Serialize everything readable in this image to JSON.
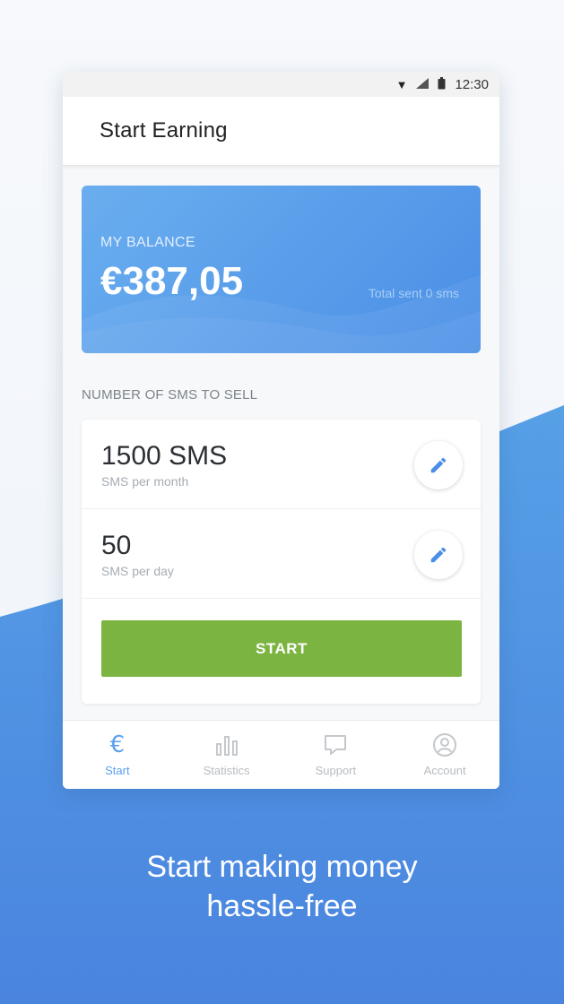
{
  "status_bar": {
    "time": "12:30",
    "icons": [
      "wifi-icon",
      "signal-icon",
      "battery-icon"
    ]
  },
  "app_bar": {
    "title": "Start Earning"
  },
  "balance": {
    "label": "MY BALANCE",
    "amount": "€387,05",
    "subtext": "Total sent 0 sms"
  },
  "sms_section": {
    "label": "NUMBER OF SMS TO SELL",
    "rows": [
      {
        "value": "1500 SMS",
        "sub": "SMS per month",
        "icon": "pencil-icon"
      },
      {
        "value": "50",
        "sub": "SMS per day",
        "icon": "pencil-icon"
      }
    ],
    "start_label": "START"
  },
  "bottom_nav": {
    "items": [
      {
        "label": "Start",
        "icon": "euro-icon",
        "active": true
      },
      {
        "label": "Statistics",
        "icon": "bar-chart-icon",
        "active": false
      },
      {
        "label": "Support",
        "icon": "chat-bubble-icon",
        "active": false
      },
      {
        "label": "Account",
        "icon": "user-circle-icon",
        "active": false
      }
    ]
  },
  "tagline": {
    "line1": "Start making money",
    "line2": "hassle-free"
  },
  "colors": {
    "accent_blue": "#4a8ee6",
    "start_green": "#7cb441",
    "background_blue": "#4f8fe0"
  }
}
